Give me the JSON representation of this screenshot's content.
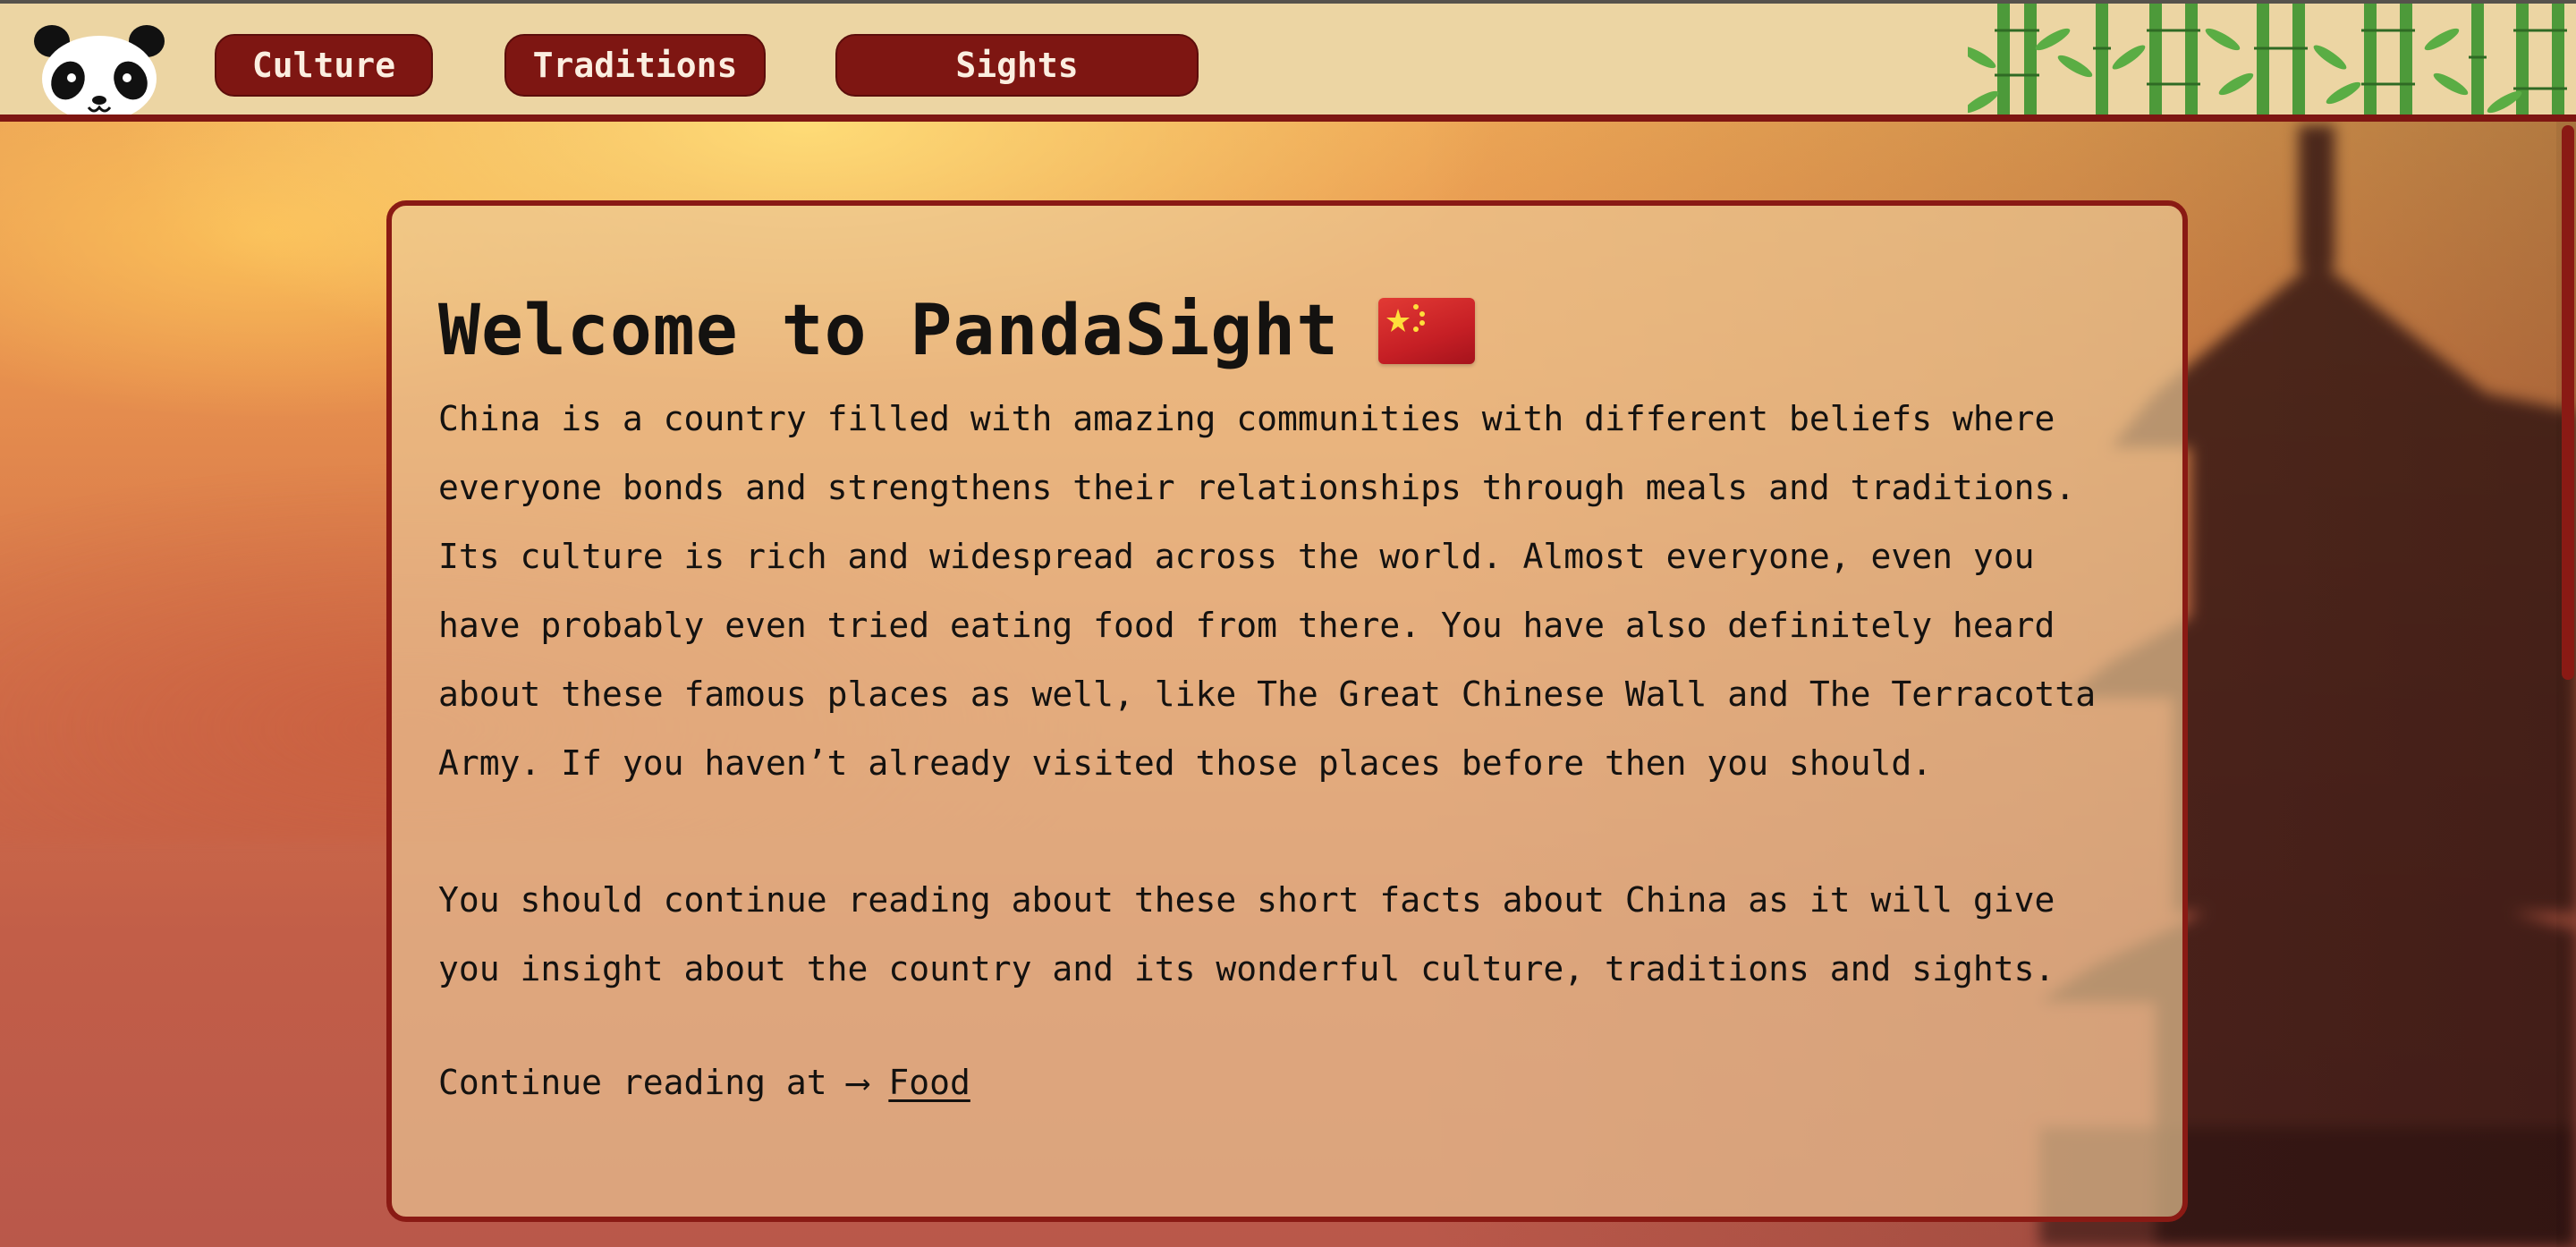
{
  "nav": {
    "logo_icon": "panda-icon",
    "items": [
      {
        "label": "Culture"
      },
      {
        "label": "Traditions"
      },
      {
        "label": "Sights"
      }
    ],
    "decoration_icon": "bamboo-icon"
  },
  "main": {
    "title": "Welcome to PandaSight",
    "title_icon": "china-flag-icon",
    "paragraph1": "China is a country filled with amazing communities with different beliefs where\neveryone bonds and strengthens their relationships through meals and traditions.\nIts culture is rich and widespread across the world. Almost everyone, even you\nhave probably even tried eating food from there. You have also definitely heard\nabout these famous places as well, like The Great Chinese Wall and The Terracotta\nArmy. If you haven’t already visited those places before then you should.",
    "paragraph2": "You should continue reading about these short facts about China as it will give\nyou insight about the country and its wonderful culture, traditions and sights.",
    "continue_prefix": "Continue reading at ⟶ ",
    "continue_link": "Food"
  },
  "colors": {
    "accent": "#7e1612",
    "topbar_bg": "#ecd5a3",
    "card_bg": "#ecc896",
    "text": "#141210"
  }
}
